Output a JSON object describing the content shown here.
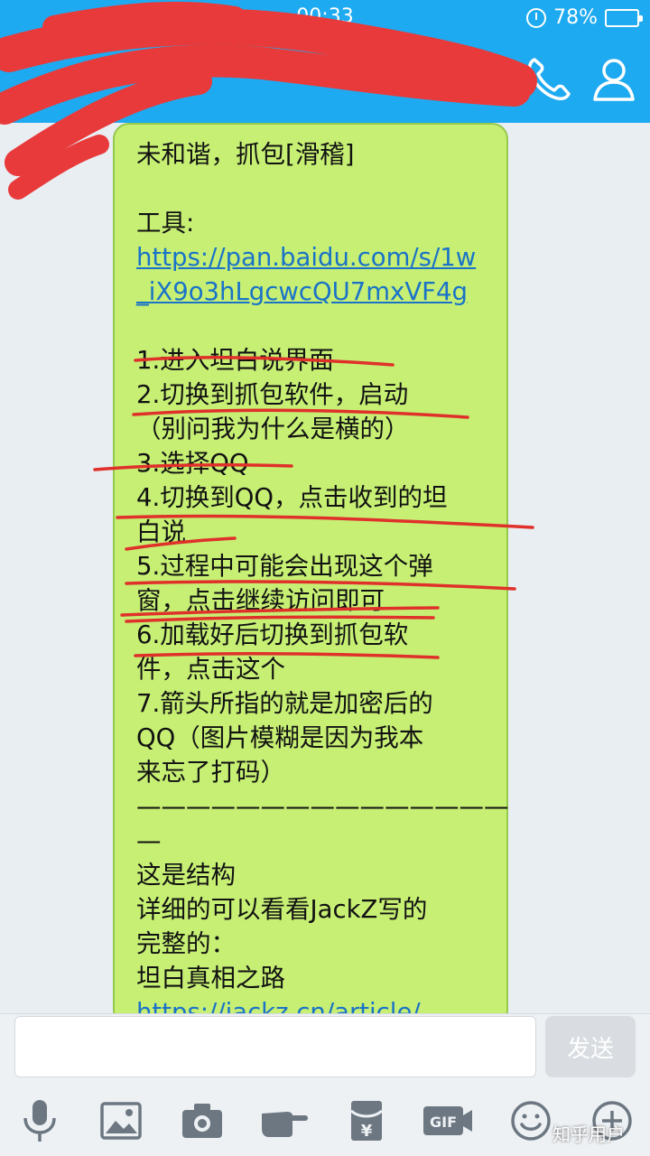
{
  "status_bar": {
    "time": "00:33",
    "battery_percent": "78%",
    "battery_level": 0.78
  },
  "title_bar": {
    "call_icon": "phone-icon",
    "profile_icon": "person-icon"
  },
  "message": {
    "lines": [
      {
        "text": "未和谐，抓包[滑稽]",
        "type": "text"
      },
      {
        "text": "",
        "type": "text"
      },
      {
        "text": "工具:",
        "type": "text"
      },
      {
        "text": "https://pan.baidu.com/s/1w",
        "type": "link"
      },
      {
        "text": "_iX9o3hLgcwcQU7mxVF4g",
        "type": "link"
      },
      {
        "text": "",
        "type": "text"
      },
      {
        "text": "1.进入坦白说界面",
        "type": "text"
      },
      {
        "text": "2.切换到抓包软件，启动",
        "type": "text"
      },
      {
        "text": "（别问我为什么是横的）",
        "type": "text"
      },
      {
        "text": "3.选择QQ",
        "type": "text"
      },
      {
        "text": "4.切换到QQ，点击收到的坦",
        "type": "text"
      },
      {
        "text": "白说",
        "type": "text"
      },
      {
        "text": "5.过程中可能会出现这个弹",
        "type": "text"
      },
      {
        "text": "窗，点击继续访问即可",
        "type": "text"
      },
      {
        "text": "6.加载好后切换到抓包软",
        "type": "text"
      },
      {
        "text": "件，点击这个",
        "type": "text"
      },
      {
        "text": "7.箭头所指的就是加密后的",
        "type": "text"
      },
      {
        "text": "QQ（图片模糊是因为我本",
        "type": "text"
      },
      {
        "text": "来忘了打码）",
        "type": "text"
      },
      {
        "text": "———————————————",
        "type": "text"
      },
      {
        "text": "—",
        "type": "text"
      },
      {
        "text": "这是结构",
        "type": "text"
      },
      {
        "text": "详细的可以看看JackZ写的",
        "type": "text"
      },
      {
        "text": "完整的：",
        "type": "text"
      },
      {
        "text": "坦白真相之路",
        "type": "text"
      },
      {
        "text": "https://jackz.cn/article/",
        "type": "link"
      }
    ]
  },
  "input_bar": {
    "placeholder": "",
    "send_label": "发送",
    "gif_label": "GIF"
  },
  "toolbar": {
    "icons": [
      "microphone-icon",
      "image-icon",
      "camera-icon",
      "poke-icon",
      "red-packet-icon",
      "gif-icon",
      "emoji-icon",
      "plus-icon"
    ]
  },
  "watermark": "知乎用户",
  "colors": {
    "header": "#1eaaf0",
    "bubble": "#c6ef74",
    "link": "#1a73c8",
    "annotation": "#e0302a",
    "redaction": "#e83a3a"
  }
}
